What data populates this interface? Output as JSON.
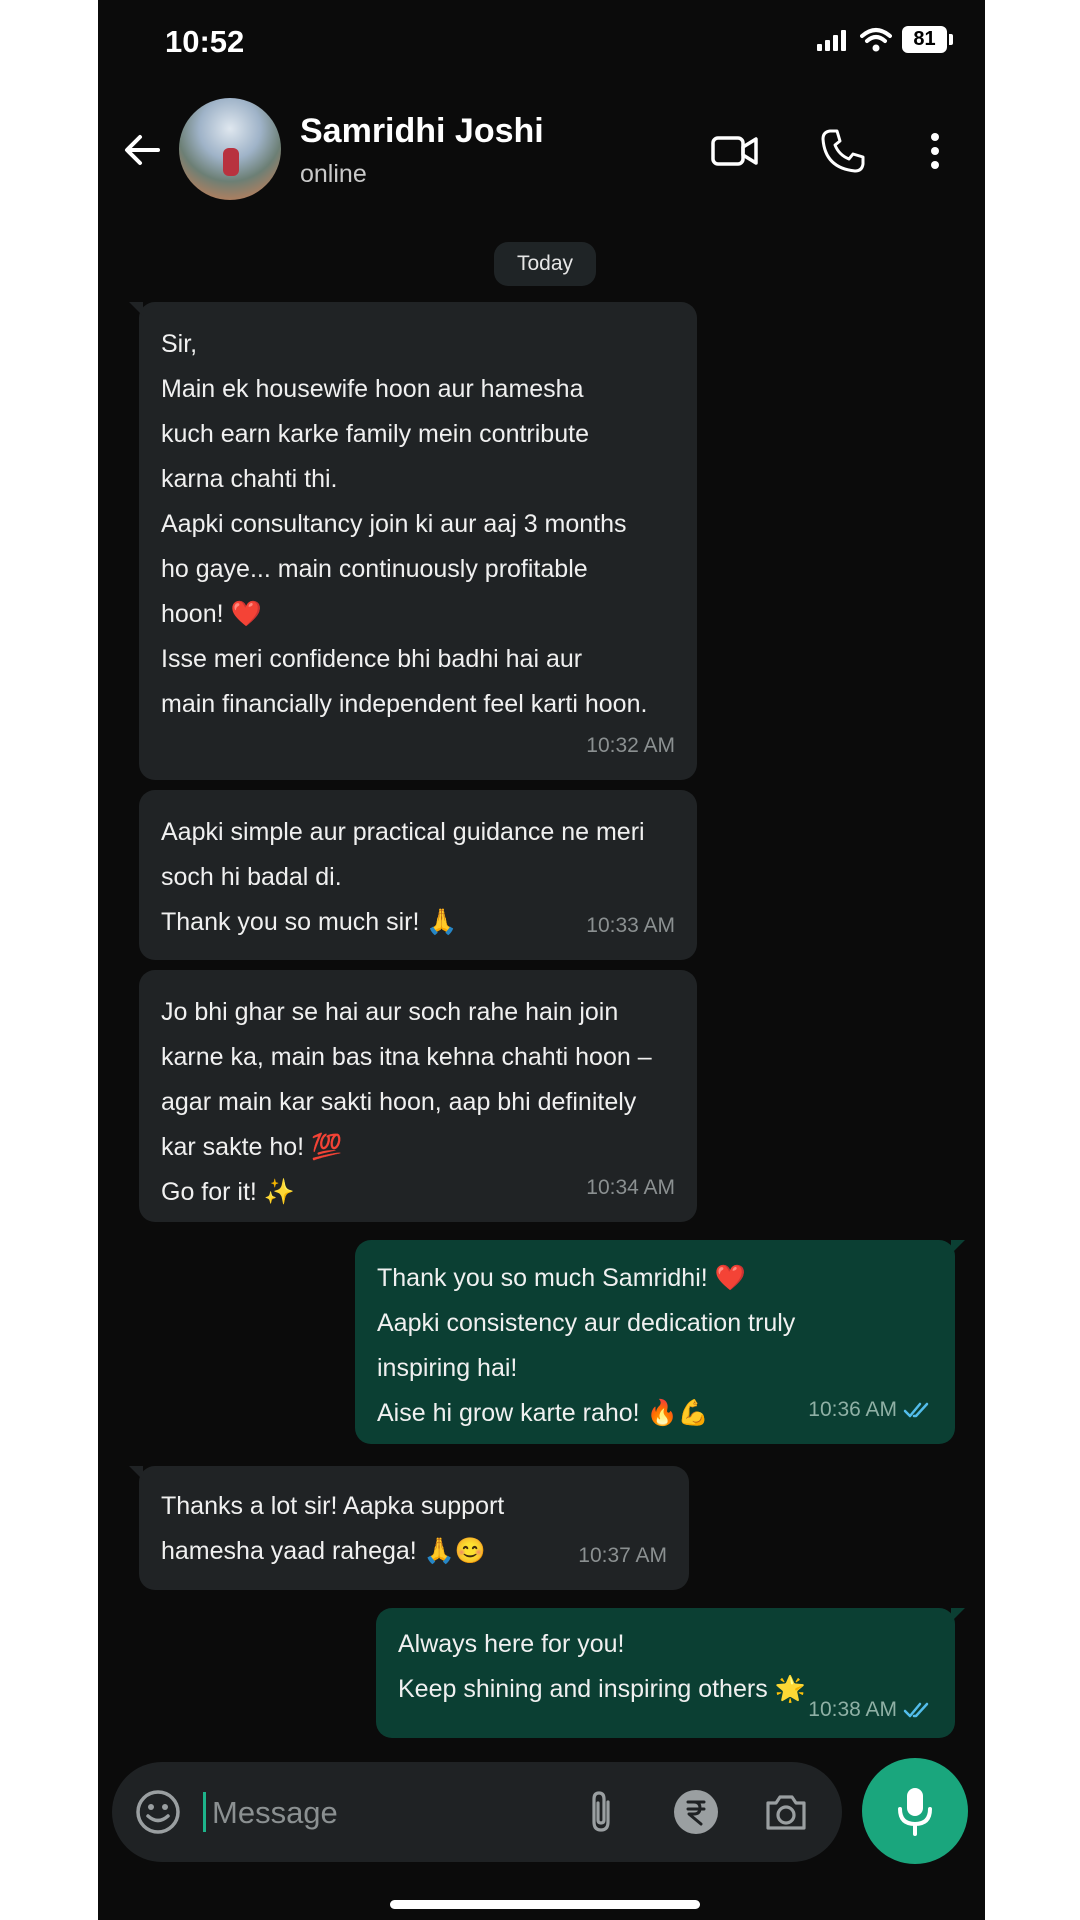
{
  "status_bar": {
    "time": "10:52",
    "battery": "81"
  },
  "header": {
    "contact_name": "Samridhi Joshi",
    "contact_status": "online"
  },
  "date_chip": "Today",
  "messages": [
    {
      "direction": "in",
      "text": "Sir,\nMain ek housewife hoon aur hamesha\nkuch earn karke family mein contribute\nkarna chahti thi.\nAapki consultancy join ki aur aaj 3 months\nho gaye... main continuously profitable\nhoon! ❤️\nIsse meri confidence bhi badhi hai aur\nmain financially independent feel karti hoon.",
      "time": "10:32 AM"
    },
    {
      "direction": "in",
      "text": "Aapki simple aur practical guidance ne meri\nsoch hi badal di.\nThank you so much sir! 🙏",
      "time": "10:33 AM"
    },
    {
      "direction": "in",
      "text": "Jo bhi ghar se hai aur soch rahe hain join\nkarne ka, main bas itna kehna chahti hoon –\nagar main kar sakti hoon, aap bhi definitely\nkar sakte ho! 💯\nGo for it! ✨",
      "time": "10:34 AM"
    },
    {
      "direction": "out",
      "text": "Thank you so much Samridhi! ❤️\nAapki consistency aur dedication truly\ninspiring hai!\nAise hi grow karte raho! 🔥💪",
      "time": "10:36 AM"
    },
    {
      "direction": "in",
      "text": "Thanks a lot sir! Aapka support\nhamesha yaad rahega! 🙏😊",
      "time": "10:37 AM"
    },
    {
      "direction": "out",
      "text": "Always here for you!\nKeep shining and inspiring others 🌟",
      "time": "10:38 AM"
    }
  ],
  "composer": {
    "placeholder": "Message"
  },
  "icons": {
    "back": "arrow-left-icon",
    "video": "video-call-icon",
    "call": "phone-icon",
    "more": "more-vertical-icon",
    "emoji": "emoji-icon",
    "attach": "paperclip-icon",
    "payment": "rupee-icon",
    "camera": "camera-icon",
    "mic": "mic-icon",
    "read": "double-check-icon"
  },
  "colors": {
    "background": "#0b0b0b",
    "incoming_bubble": "#202325",
    "outgoing_bubble": "#0b3f33",
    "accent": "#1aa67d",
    "read_tick": "#53bdeb"
  }
}
